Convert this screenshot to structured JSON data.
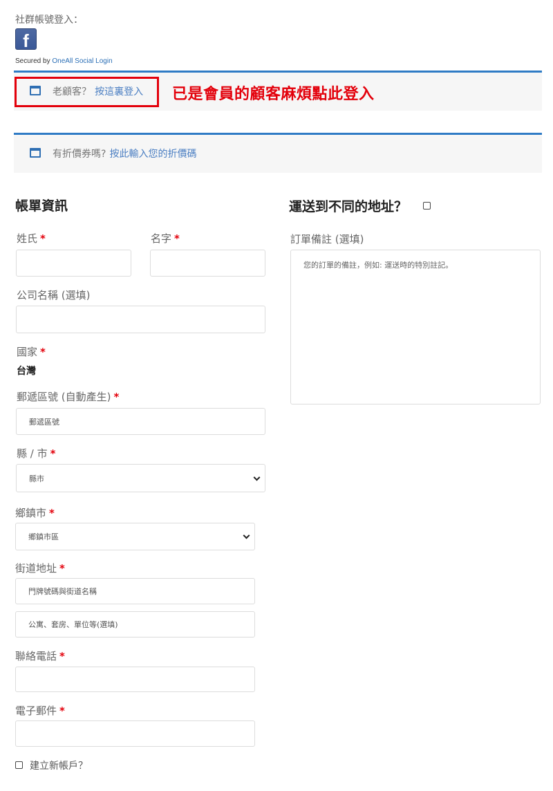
{
  "social_login": {
    "title": "社群帳號登入：",
    "facebook_glyph": "f",
    "secured_by": "Secured by",
    "oneall_link": "OneAll Social Login"
  },
  "login_notice": {
    "text": "老顧客？",
    "link": "按這裏登入",
    "annotation": "已是會員的顧客麻煩點此登入"
  },
  "coupon_notice": {
    "text": "有折價券嗎?",
    "link": "按此輸入您的折價碼"
  },
  "billing": {
    "heading": "帳單資訊",
    "required_mark": "*",
    "last_name_label": "姓氏",
    "first_name_label": "名字",
    "company_label": "公司名稱 (選填)",
    "country_label": "國家",
    "country_value": "台灣",
    "postcode_label": "郵遞區號 (自動產生)",
    "postcode_placeholder": "郵遞區號",
    "county_label": "縣 / 市",
    "county_placeholder": "縣市",
    "township_label": "鄉鎮市",
    "township_placeholder": "鄉鎮市區",
    "street_label": "街道地址",
    "street1_placeholder": "門牌號碼與街道名稱",
    "street2_placeholder": "公寓、套房、單位等(選填)",
    "phone_label": "聯絡電話",
    "email_label": "電子郵件",
    "create_account_label": "建立新帳戶？"
  },
  "shipping": {
    "heading": "運送到不同的地址？",
    "notes_label": "訂單備註 (選填)",
    "notes_placeholder": "您的訂單的備註，例如: 運送時的特別註記。"
  },
  "colors": {
    "accent_blue": "#2f7bc5",
    "required_red": "#e3000b",
    "facebook_blue": "#3b5998"
  }
}
